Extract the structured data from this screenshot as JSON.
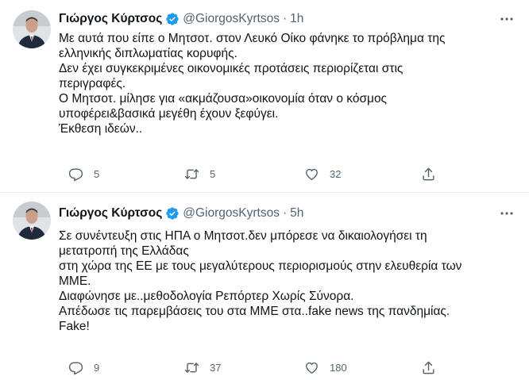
{
  "colors": {
    "text": "#0f1419",
    "secondary": "#536471",
    "verified": "#1d9bf0",
    "divider": "#e6ecf0"
  },
  "tweets": [
    {
      "author_name": "Γιώργος Κύρτσος",
      "handle": "@GiorgosKyrtsos",
      "separator": "·",
      "time": "1h",
      "verified": true,
      "lines": [
        "Με αυτά που είπε ο Μητσοτ. στον Λευκό Οίκο φάνηκε το πρόβλημα της",
        "ελληνικής διπλωματίας κορυφής.",
        "Δεν έχει συγκεκριμένες οικονομικές προτάσεις περιορίζεται στις",
        "περιγραφές.",
        "Ο Μητσοτ. μίλησε για «ακμάζουσα»οικονομία όταν ο κόσμος",
        "υποφέρει&βασικά μεγέθη έχουν ξεφύγει.",
        "Έκθεση ιδεών.."
      ],
      "replies": "5",
      "retweets": "5",
      "likes": "32"
    },
    {
      "author_name": "Γιώργος Κύρτσος",
      "handle": "@GiorgosKyrtsos",
      "separator": "·",
      "time": "5h",
      "verified": true,
      "lines": [
        "Σε συνέντευξη στις ΗΠΑ ο Μητσοτ.δεν μπόρεσε να δικαιολογήσει τη",
        "μετατροπή της Ελλάδας",
        "στη χώρα της ΕΕ με τους μεγαλύτερους περιορισμούς στην ελευθερία των",
        "ΜΜΕ.",
        "Διαφώνησε με..μεθοδολογία Ρεπόρτερ Χωρίς Σύνορα.",
        "Απέδωσε τις παρεμβάσεις του στα ΜΜΕ στα..fake news της πανδημίας.",
        "Fake!"
      ],
      "replies": "9",
      "retweets": "37",
      "likes": "180"
    }
  ],
  "icons": {
    "reply": "reply-icon",
    "retweet": "retweet-icon",
    "like": "heart-icon",
    "share": "share-icon",
    "more": "more-icon",
    "verified": "verified-badge-icon"
  }
}
